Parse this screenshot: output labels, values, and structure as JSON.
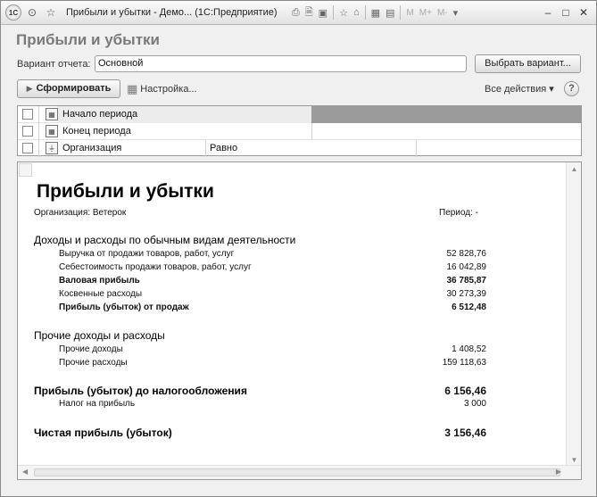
{
  "window": {
    "logo": "1С",
    "title": "Прибыли и убытки - Демо... (1С:Предприятие)",
    "toolbar_m": [
      "M",
      "M+",
      "M-"
    ]
  },
  "form": {
    "title": "Прибыли и убытки",
    "variant_label": "Вариант отчета:",
    "variant_value": "Основной",
    "choose_variant_button": "Выбрать вариант...",
    "generate_button": "Сформировать",
    "settings_link": "Настройка...",
    "all_actions": "Все действия",
    "help": "?"
  },
  "settings_rows": [
    {
      "label": "Начало периода",
      "comparison": ""
    },
    {
      "label": "Конец периода",
      "comparison": ""
    },
    {
      "label": "Организация",
      "comparison": "Равно"
    }
  ],
  "report": {
    "title": "Прибыли и убытки",
    "organization": "Организация: Ветерок",
    "period": "Период:  -",
    "section1": "Доходы и расходы по обычным видам деятельности",
    "rows1": [
      {
        "label": "Выручка от продажи товаров, работ, услуг",
        "value": "52 828,76",
        "bold": false
      },
      {
        "label": "Себестоимость продажи товаров, работ, услуг",
        "value": "16 042,89",
        "bold": false
      },
      {
        "label": "Валовая прибыль",
        "value": "36 785,87",
        "bold": true
      },
      {
        "label": "Косвенные расходы",
        "value": "30 273,39",
        "bold": false
      },
      {
        "label": "Прибыль (убыток) от продаж",
        "value": "6 512,48",
        "bold": true
      }
    ],
    "section2": "Прочие доходы и расходы",
    "rows2": [
      {
        "label": "Прочие доходы",
        "value": "1 408,52"
      },
      {
        "label": "Прочие расходы",
        "value": "159 118,63"
      }
    ],
    "pretax_label": "Прибыль (убыток) до налогообложения",
    "pretax_value": "6 156,46",
    "tax_label": "Налог на прибыль",
    "tax_value": "3 000",
    "net_label": "Чистая прибыль (убыток)",
    "net_value": "3 156,46"
  }
}
